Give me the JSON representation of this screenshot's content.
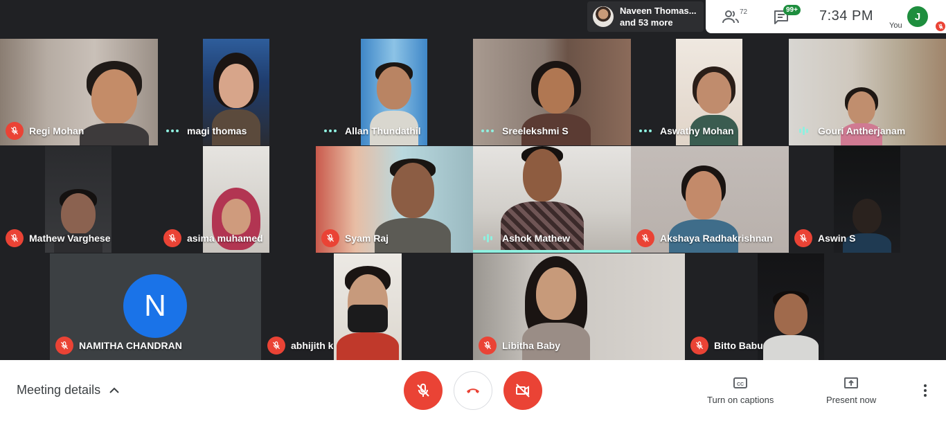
{
  "topbar": {
    "presenter_line1": "Naveen Thomas...",
    "presenter_line2": "and 53 more",
    "people_count": "72",
    "chat_badge": "99+",
    "clock": "7:34  PM",
    "you_initial": "J",
    "you_label": "You"
  },
  "tiles": [
    {
      "name": "Regi Mohan",
      "status": "muted"
    },
    {
      "name": "magi thomas",
      "status": "dots"
    },
    {
      "name": "Allan Thundathil",
      "status": "dots"
    },
    {
      "name": "Sreelekshmi S",
      "status": "dots"
    },
    {
      "name": "Aswathy Mohan",
      "status": "dots"
    },
    {
      "name": "Gouri Antherjanam",
      "status": "bars"
    },
    {
      "name": "Mathew Varghese",
      "status": "muted"
    },
    {
      "name": "asima muhamed",
      "status": "muted"
    },
    {
      "name": "Syam Raj",
      "status": "muted"
    },
    {
      "name": "Ashok Mathew",
      "status": "speaking"
    },
    {
      "name": "Akshaya Radhakrishnan",
      "status": "muted"
    },
    {
      "name": "Aswin S",
      "status": "muted"
    },
    {
      "name": "NAMITHA CHANDRAN",
      "status": "muted",
      "avatar_initial": "N"
    },
    {
      "name": "abhijith k",
      "status": "muted"
    },
    {
      "name": "Libitha Baby",
      "status": "muted"
    },
    {
      "name": "Bitto Babu",
      "status": "muted"
    }
  ],
  "bottombar": {
    "meeting_details": "Meeting details",
    "captions_label": "Turn on captions",
    "present_label": "Present now"
  },
  "colors": {
    "background": "#202124",
    "tile": "#3c4043",
    "danger": "#ea4335",
    "speaking": "#8ff0e0",
    "avatar_blue": "#1a73e8",
    "badge_green": "#1e8e3e"
  },
  "icons": [
    "people-icon",
    "chat-icon",
    "mic-off-icon",
    "end-call-icon",
    "camera-off-icon",
    "captions-icon",
    "present-icon",
    "more-vert-icon",
    "chevron-up-icon"
  ]
}
